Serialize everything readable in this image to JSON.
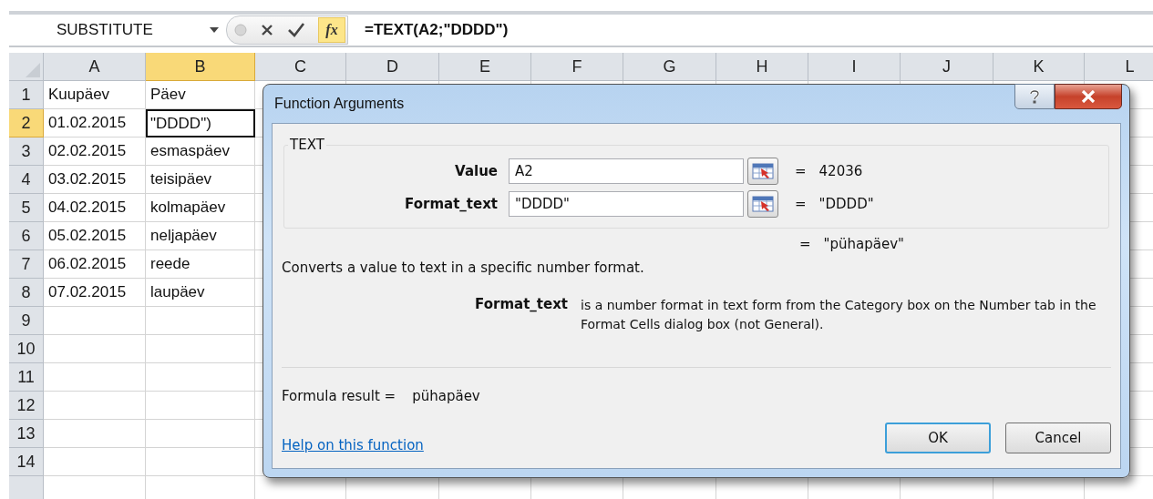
{
  "formula_bar": {
    "name_box": "SUBSTITUTE",
    "function_button": "fx",
    "formula": "=TEXT(A2;\"DDDD\")"
  },
  "sheet": {
    "columns": [
      {
        "label": "A",
        "selected": false
      },
      {
        "label": "B",
        "selected": true
      },
      {
        "label": "C",
        "selected": false
      },
      {
        "label": "D",
        "selected": false
      },
      {
        "label": "E",
        "selected": false
      },
      {
        "label": "F",
        "selected": false
      },
      {
        "label": "G",
        "selected": false
      },
      {
        "label": "H",
        "selected": false
      },
      {
        "label": "I",
        "selected": false
      },
      {
        "label": "J",
        "selected": false
      },
      {
        "label": "K",
        "selected": false
      },
      {
        "label": "L",
        "selected": false
      }
    ],
    "rows": [
      {
        "label": "1",
        "selected": false,
        "cells": [
          {
            "text": "Kuupäev",
            "active": false
          },
          {
            "text": "Päev",
            "active": false
          }
        ]
      },
      {
        "label": "2",
        "selected": true,
        "cells": [
          {
            "text": "01.02.2015",
            "active": false
          },
          {
            "text": "\"DDDD\")",
            "active": true
          }
        ]
      },
      {
        "label": "3",
        "selected": false,
        "cells": [
          {
            "text": "02.02.2015",
            "active": false
          },
          {
            "text": "esmaspäev",
            "active": false
          }
        ]
      },
      {
        "label": "4",
        "selected": false,
        "cells": [
          {
            "text": "03.02.2015",
            "active": false
          },
          {
            "text": "teisipäev",
            "active": false
          }
        ]
      },
      {
        "label": "5",
        "selected": false,
        "cells": [
          {
            "text": "04.02.2015",
            "active": false
          },
          {
            "text": "kolmapäev",
            "active": false
          }
        ]
      },
      {
        "label": "6",
        "selected": false,
        "cells": [
          {
            "text": "05.02.2015",
            "active": false
          },
          {
            "text": "neljapäev",
            "active": false
          }
        ]
      },
      {
        "label": "7",
        "selected": false,
        "cells": [
          {
            "text": "06.02.2015",
            "active": false
          },
          {
            "text": "reede",
            "active": false
          }
        ]
      },
      {
        "label": "8",
        "selected": false,
        "cells": [
          {
            "text": "07.02.2015",
            "active": false
          },
          {
            "text": "laupäev",
            "active": false
          }
        ]
      },
      {
        "label": "9",
        "selected": false,
        "cells": []
      },
      {
        "label": "10",
        "selected": false,
        "cells": []
      },
      {
        "label": "11",
        "selected": false,
        "cells": []
      },
      {
        "label": "12",
        "selected": false,
        "cells": []
      },
      {
        "label": "13",
        "selected": false,
        "cells": []
      },
      {
        "label": "14",
        "selected": false,
        "cells": []
      }
    ]
  },
  "dialog": {
    "title": "Function Arguments",
    "function_name": "TEXT",
    "arguments": [
      {
        "label": "Value",
        "value": "A2",
        "equals": "=",
        "result": "42036"
      },
      {
        "label": "Format_text",
        "value": "\"DDDD\"",
        "equals": "=",
        "result": "\"DDDD\""
      }
    ],
    "result": {
      "equals": "=",
      "value": "\"pühapäev\""
    },
    "description": "Converts a value to text in a specific number format.",
    "argument_help": {
      "name": "Format_text",
      "text": "is a number format in text form from the Category box on the Number tab in the Format Cells dialog box (not General)."
    },
    "formula_result": {
      "label": "Formula result =",
      "value": "pühapäev"
    },
    "help_link": "Help on this function",
    "buttons": [
      {
        "label": "OK",
        "default": true
      },
      {
        "label": "Cancel",
        "default": false
      }
    ]
  }
}
